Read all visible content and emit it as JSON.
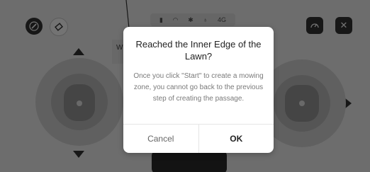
{
  "dialog": {
    "title": "Reached the Inner Edge of the Lawn?",
    "message": "Once you click \"Start\" to create a mowing zone, you cannot go back to the previous step of creating the passage.",
    "cancel_label": "Cancel",
    "ok_label": "OK"
  },
  "background": {
    "side_label_fragment": "W",
    "status_icons": [
      "battery-icon",
      "wifi-icon",
      "bluetooth-icon",
      "satellite-icon",
      "signal-4g-icon"
    ],
    "signal_label": "4G"
  },
  "colors": {
    "overlay": "#000000",
    "dialog_bg": "#ffffff",
    "title_text": "#222222",
    "body_text": "#7a7a7a"
  }
}
